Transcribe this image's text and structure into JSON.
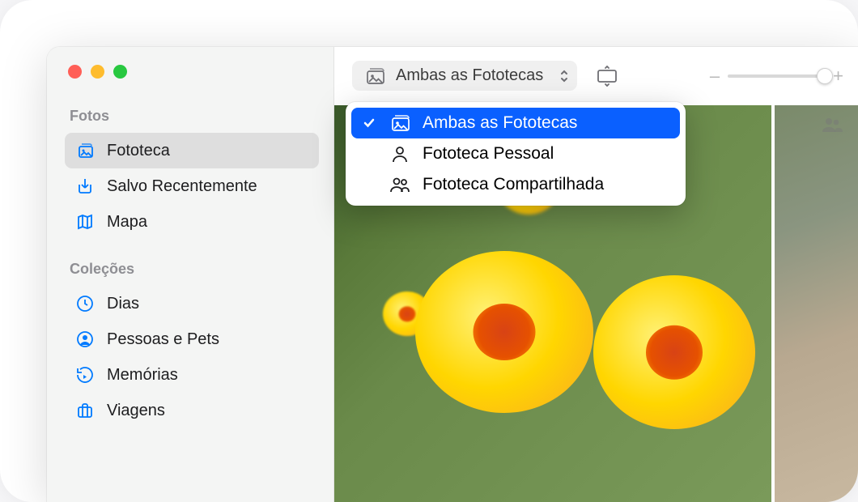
{
  "sidebar": {
    "sections": [
      {
        "header": "Fotos",
        "items": [
          {
            "label": "Fototeca",
            "selected": true
          },
          {
            "label": "Salvo Recentemente",
            "selected": false
          },
          {
            "label": "Mapa",
            "selected": false
          }
        ]
      },
      {
        "header": "Coleções",
        "items": [
          {
            "label": "Dias",
            "selected": false
          },
          {
            "label": "Pessoas e Pets",
            "selected": false
          },
          {
            "label": "Memórias",
            "selected": false
          },
          {
            "label": "Viagens",
            "selected": false
          }
        ]
      }
    ]
  },
  "toolbar": {
    "librarySwitcher": {
      "label": "Ambas as Fototecas"
    },
    "zoom": {
      "minusLabel": "–",
      "plusLabel": "+"
    }
  },
  "dropdown": {
    "items": [
      {
        "label": "Ambas as Fototecas",
        "checked": true
      },
      {
        "label": "Fototeca Pessoal",
        "checked": false
      },
      {
        "label": "Fototeca Compartilhada",
        "checked": false
      }
    ]
  }
}
